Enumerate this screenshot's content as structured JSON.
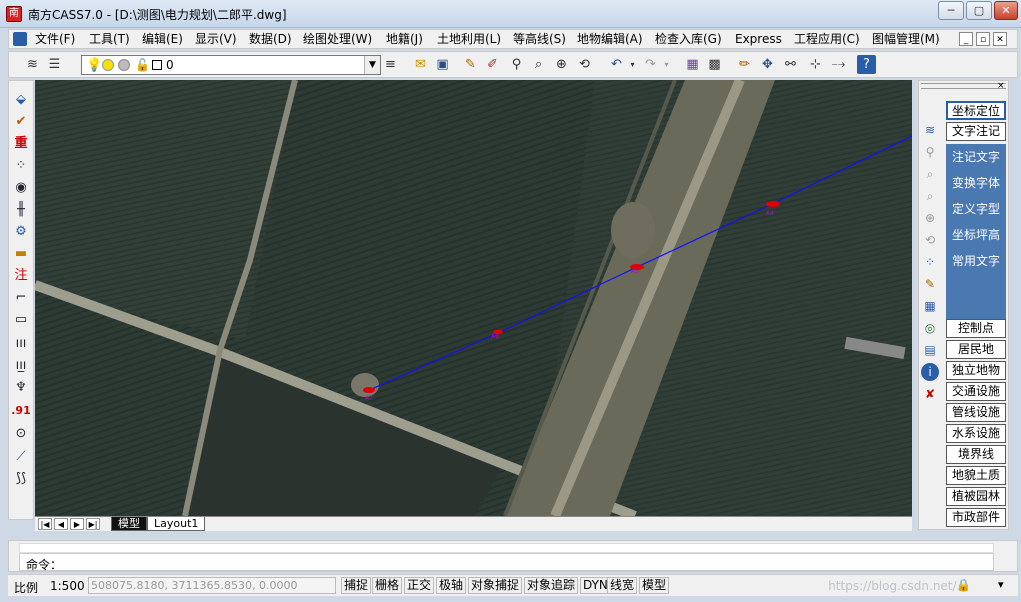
{
  "window": {
    "title": "南方CASS7.0 - [D:\\测图\\电力规划\\二郎平.dwg]",
    "app_icon": "cass-app-icon",
    "minimize": "─",
    "maximize": "▢",
    "close": "✕"
  },
  "menu": {
    "items": [
      "文件(F)",
      "工具(T)",
      "编辑(E)",
      "显示(V)",
      "数据(D)",
      "绘图处理(W)",
      "地籍(J)",
      "土地利用(L)",
      "等高线(S)",
      "地物编辑(A)",
      "检查入库(G)",
      "Express",
      "工程应用(C)",
      "图幅管理(M)"
    ],
    "doc_controls": [
      "_",
      "▫",
      "✕"
    ]
  },
  "toolbar": {
    "layer_value": "0",
    "icons": [
      "layers-icon",
      "layer-manager-icon",
      "bulb-icon",
      "sun-icon",
      "lock-icon",
      "color-icon",
      "linetype-icon",
      "open-icon",
      "save-icon",
      "pencil-icon",
      "edit-icon",
      "zoom-realtime-icon",
      "zoom-window-icon",
      "zoom-in-icon",
      "zoom-previous-icon",
      "undo-icon",
      "redo-icon",
      "properties-icon",
      "grid-icon",
      "draw-line-icon",
      "move-icon",
      "snap-icon",
      "dimension-icon",
      "measure-icon",
      "help-icon"
    ]
  },
  "left_toolbar": {
    "icons": [
      "tag-icon",
      "check-icon",
      "heavy-icon",
      "point-grid-icon",
      "camera-icon",
      "fence-icon",
      "settings-icon",
      "ruler-icon",
      "annotate-icon",
      "polyline-icon",
      "rectangle-icon",
      "comb-icon",
      "comb2-icon",
      "tree-icon",
      "elevation-icon",
      "circle-icon",
      "line-icon",
      "wave-icon"
    ],
    "labels": {
      "heavy": "重",
      "annotate": "注",
      "elevation": ".91"
    }
  },
  "canvas": {
    "points": [
      {
        "label": "A4",
        "color": "#e00000"
      },
      {
        "label": "A5",
        "color": "#e00000"
      },
      {
        "label": "A6",
        "color": "#e00000"
      },
      {
        "label": "A7",
        "color": "#e00000"
      }
    ],
    "line_color": "#1010ff"
  },
  "tabs": {
    "nav": [
      "|◀",
      "◀",
      "▶",
      "▶|"
    ],
    "items": [
      {
        "label": "模型",
        "active": true
      },
      {
        "label": "Layout1",
        "active": false
      }
    ]
  },
  "right_panel": {
    "top_buttons": [
      "坐标定位",
      "文字注记"
    ],
    "sub_items": [
      "注记文字",
      "变换字体",
      "定义字型",
      "坐标坪高",
      "常用文字"
    ],
    "category_buttons": [
      "控制点",
      "居民地",
      "独立地物",
      "交通设施",
      "管线设施",
      "水系设施",
      "境界线",
      "地貌土质",
      "植被园林",
      "市政部件"
    ],
    "icons": [
      "layers-icon",
      "zoom-realtime-icon",
      "zoom-window-icon",
      "zoom-previous-icon",
      "zoom-in-icon",
      "undo-view-icon",
      "point-grid-icon",
      "edit-icon",
      "layer-manager-icon",
      "target-icon",
      "grid-icon",
      "info-icon",
      "delete-icon"
    ]
  },
  "command": {
    "prompt": "命令："
  },
  "status_bar": {
    "scale_label": "比例",
    "scale_value": "1:500",
    "coordinates": "508075.8180, 3711365.8530, 0.0000",
    "toggles": [
      "捕捉",
      "栅格",
      "正交",
      "极轴",
      "对象捕捉",
      "对象追踪",
      "DYN",
      "线宽",
      "模型"
    ],
    "watermark": "https://blog.csdn.net/..."
  }
}
